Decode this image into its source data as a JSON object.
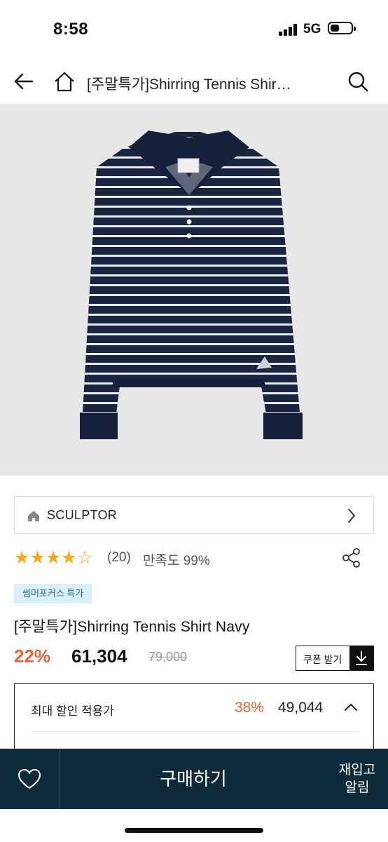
{
  "status_bar": {
    "time": "8:58",
    "network": "5G"
  },
  "header": {
    "title": "[주말특가]Shirring Tennis Shir…"
  },
  "brand": {
    "name": "SCULPTOR"
  },
  "rating": {
    "stars": 4,
    "max_stars": 5,
    "review_count": "(20)",
    "satisfaction": "만족도 99%"
  },
  "promo": {
    "badge": "썸머포커스 특가"
  },
  "product": {
    "title": "[주말특가]Shirring Tennis Shirt Navy",
    "discount": "22%",
    "price": "61,304",
    "original_price": "79,000",
    "coupon_label": "쿠폰 받기"
  },
  "max_discount": {
    "label": "최대 할인 적용가",
    "percent": "38%",
    "price": "49,044"
  },
  "bottom_bar": {
    "buy_label": "구매하기",
    "restock_line1": "재입고",
    "restock_line2": "알림"
  },
  "colors": {
    "accent": "#f0623a",
    "bottom_bar": "#0f2b3b",
    "star": "#f5a623",
    "badge_bg": "#d9f0fb"
  }
}
